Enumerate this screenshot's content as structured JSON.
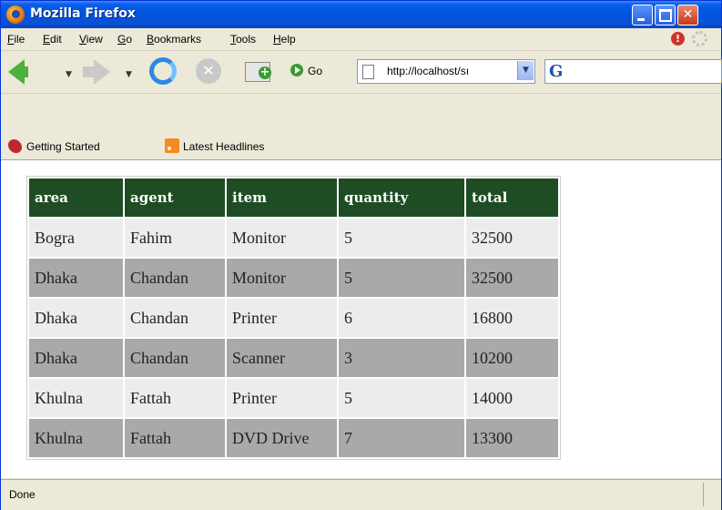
{
  "window": {
    "title": "Mozilla Firefox"
  },
  "menu": {
    "items": [
      "File",
      "Edit",
      "View",
      "Go",
      "Bookmarks",
      "Tools",
      "Help"
    ]
  },
  "toolbar": {
    "go_label": "Go",
    "url": "http://localhost/sı"
  },
  "bookmarks": {
    "items": [
      {
        "label": "Getting Started",
        "icon": "getting-started-icon"
      },
      {
        "label": "Latest Headlines",
        "icon": "rss-feed-icon"
      }
    ]
  },
  "table": {
    "headers": [
      "area",
      "agent",
      "item",
      "quantity",
      "total"
    ],
    "rows": [
      [
        "Bogra",
        "Fahim",
        "Monitor",
        "5",
        "32500"
      ],
      [
        "Dhaka",
        "Chandan",
        "Monitor",
        "5",
        "32500"
      ],
      [
        "Dhaka",
        "Chandan",
        "Printer",
        "6",
        "16800"
      ],
      [
        "Dhaka",
        "Chandan",
        "Scanner",
        "3",
        "10200"
      ],
      [
        "Khulna",
        "Fattah",
        "Printer",
        "5",
        "14000"
      ],
      [
        "Khulna",
        "Fattah",
        "DVD Drive",
        "7",
        "13300"
      ]
    ],
    "colors": {
      "header": "#1f4d23",
      "row_light": "#ebeded",
      "row_dark": "#a9a9a9"
    }
  },
  "status": {
    "text": "Done"
  }
}
